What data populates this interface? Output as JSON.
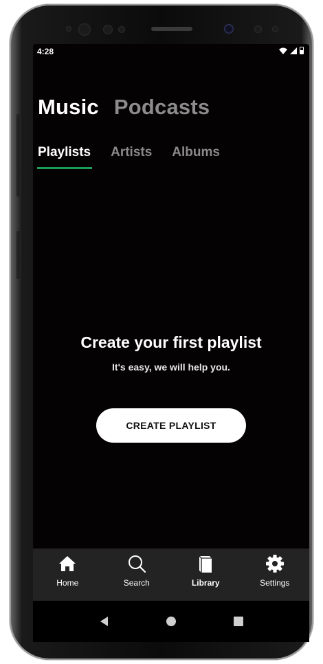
{
  "status_bar": {
    "time": "4:28"
  },
  "section_tabs": [
    {
      "label": "Music",
      "active": true
    },
    {
      "label": "Podcasts",
      "active": false
    }
  ],
  "sub_tabs": [
    {
      "label": "Playlists",
      "active": true
    },
    {
      "label": "Artists",
      "active": false
    },
    {
      "label": "Albums",
      "active": false
    }
  ],
  "empty_state": {
    "title": "Create your first playlist",
    "subtitle": "It's easy, we will help you.",
    "button_label": "CREATE PLAYLIST"
  },
  "bottom_nav": [
    {
      "label": "Home",
      "icon": "home-icon",
      "active": false
    },
    {
      "label": "Search",
      "icon": "search-icon",
      "active": false
    },
    {
      "label": "Library",
      "icon": "library-icon",
      "active": true
    },
    {
      "label": "Settings",
      "icon": "gear-icon",
      "active": false
    }
  ],
  "colors": {
    "screen_background": "#050203",
    "accent_underline": "#1e9e54",
    "bottom_nav_background": "#232323",
    "inactive_text": "#8c8c8c"
  }
}
